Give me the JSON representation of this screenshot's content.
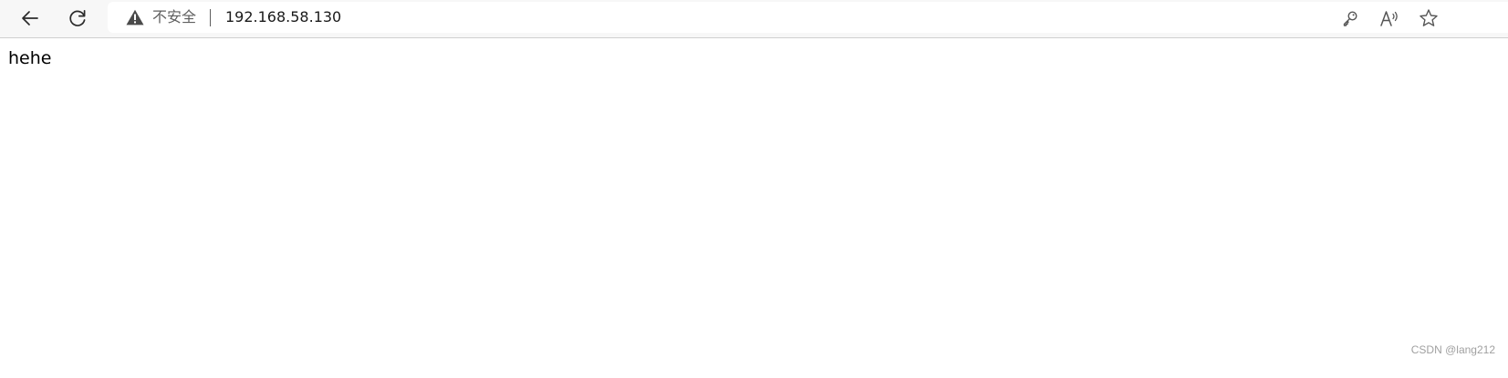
{
  "toolbar": {
    "back_icon": "back-arrow-icon",
    "reload_icon": "reload-icon"
  },
  "address_bar": {
    "security_icon": "warning-triangle-icon",
    "security_label": "不安全",
    "url": "192.168.58.130",
    "right_icons": [
      "key-icon",
      "read-aloud-icon",
      "favorite-star-icon"
    ]
  },
  "page": {
    "body_text": "hehe"
  },
  "watermark": {
    "text": "CSDN @lang212"
  }
}
